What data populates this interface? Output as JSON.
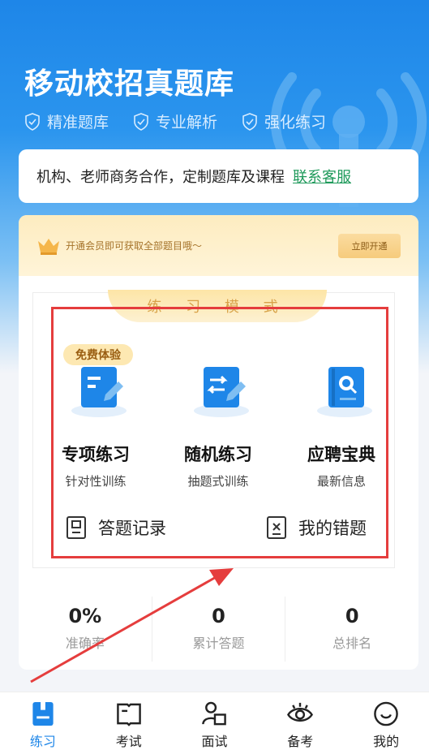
{
  "header": {
    "title": "移动校招真题库",
    "features": [
      "精准题库",
      "专业解析",
      "强化练习"
    ]
  },
  "promo": {
    "text": "机构、老师商务合作，定制题库及课程",
    "link": "联系客服"
  },
  "vip": {
    "text": "开通会员即可获取全部题目哦～",
    "button": "立即开通"
  },
  "practice": {
    "mode_title": "练 习 模 式",
    "free_badge": "免费体验",
    "modes": [
      {
        "title": "专项练习",
        "subtitle": "针对性训练",
        "icon": "list-edit-icon"
      },
      {
        "title": "随机练习",
        "subtitle": "抽题式训练",
        "icon": "shuffle-edit-icon"
      },
      {
        "title": "应聘宝典",
        "subtitle": "最新信息",
        "icon": "search-book-icon"
      }
    ],
    "links": [
      {
        "label": "答题记录",
        "icon": "record-icon"
      },
      {
        "label": "我的错题",
        "icon": "wrong-question-icon"
      }
    ]
  },
  "stats": [
    {
      "value": "0%",
      "label": "准确率"
    },
    {
      "value": "0",
      "label": "累计答题"
    },
    {
      "value": "0",
      "label": "总排名"
    }
  ],
  "tabbar": {
    "items": [
      {
        "label": "练习",
        "icon": "practice-icon",
        "active": true
      },
      {
        "label": "考试",
        "icon": "exam-icon",
        "active": false
      },
      {
        "label": "面试",
        "icon": "interview-icon",
        "active": false
      },
      {
        "label": "备考",
        "icon": "prepare-icon",
        "active": false
      },
      {
        "label": "我的",
        "icon": "profile-icon",
        "active": false
      }
    ]
  },
  "colors": {
    "primary": "#1e86e8",
    "link_green": "#1f9a5b",
    "highlight_red": "#e53d3d",
    "vip_gold": "#a5732a"
  }
}
